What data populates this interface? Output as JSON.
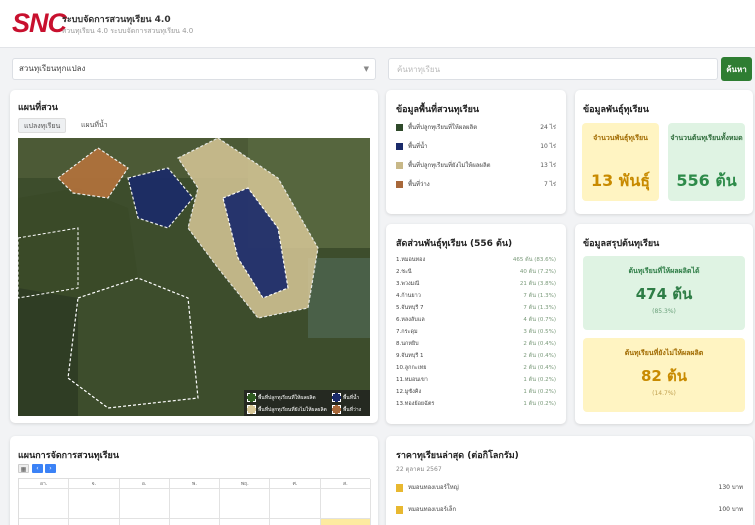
{
  "header": {
    "logo": "SNC",
    "title": "ระบบจัดการสวนทุเรียน 4.0",
    "subtitle": "สวนทุเรียน 4.0 ระบบจัดการสวนทุเรียน 4.0"
  },
  "filter": {
    "select_value": "สวนทุเรียนทุกแปลง",
    "search_placeholder": "ค้นหาทุเรียน",
    "search_button": "ค้นหา"
  },
  "map": {
    "title": "แผนที่สวน",
    "tabs": [
      "แปลงทุเรียน",
      "แผนที่น้ำ"
    ],
    "legend": [
      {
        "label": "พื้นที่ปลูกทุเรียนที่ให้ผลผลิต",
        "color": "#2f5a20"
      },
      {
        "label": "พื้นที่น้ำ",
        "color": "#1a2a6a"
      },
      {
        "label": "พื้นที่ปลูกทุเรียนที่ยังไม่ให้ผลผลิต",
        "color": "#d8c898"
      },
      {
        "label": "พื้นที่ว่าง",
        "color": "#a8683a"
      }
    ]
  },
  "area": {
    "title": "ข้อมูลพื้นที่สวนทุเรียน",
    "rows": [
      {
        "label": "พื้นที่ปลูกทุเรียนที่ให้ผลผลิต",
        "value": "24 ไร่",
        "color": "#2f4a2a"
      },
      {
        "label": "พื้นที่น้ำ",
        "value": "10 ไร่",
        "color": "#1a2a6a"
      },
      {
        "label": "พื้นที่ปลูกทุเรียนที่ยังไม่ให้ผลผลิต",
        "value": "13 ไร่",
        "color": "#c8b888"
      },
      {
        "label": "พื้นที่ว่าง",
        "value": "7 ไร่",
        "color": "#a8683a"
      }
    ]
  },
  "varieties": {
    "title": "ข้อมูลพันธุ์ทุเรียน",
    "count_label": "จำนวนพันธุ์ทุเรียน",
    "count_value": "13 พันธุ์",
    "trees_label": "จำนวนต้นทุเรียนทั้งหมด",
    "trees_value": "556 ต้น"
  },
  "ratio": {
    "title": "สัดส่วนพันธุ์ทุเรียน (556 ต้น)",
    "rows": [
      {
        "name": "1.หมอนทอง",
        "value": "465 ต้น (83.6%)"
      },
      {
        "name": "2.ชะนี",
        "value": "40 ต้น (7.2%)"
      },
      {
        "name": "3.พวงมณี",
        "value": "21 ต้น (3.8%)"
      },
      {
        "name": "4.ก้านยาว",
        "value": "7 ต้น (1.3%)"
      },
      {
        "name": "5.จันทบุรี 7",
        "value": "7 ต้น (1.3%)"
      },
      {
        "name": "6.หลงลับแล",
        "value": "4 ต้น (0.7%)"
      },
      {
        "name": "7.กระดุม",
        "value": "3 ต้น (0.5%)"
      },
      {
        "name": "8.นกหยิบ",
        "value": "2 ต้น (0.4%)"
      },
      {
        "name": "9.จันทบุรี 1",
        "value": "2 ต้น (0.4%)"
      },
      {
        "name": "10.ลูกกะเทย",
        "value": "2 ต้น (0.4%)"
      },
      {
        "name": "11.หมอนเขา",
        "value": "1 ต้น (0.2%)"
      },
      {
        "name": "12.มูซังคิง",
        "value": "1 ต้น (0.2%)"
      },
      {
        "name": "13.ทองย้อยฉัตร",
        "value": "1 ต้น (0.2%)"
      }
    ]
  },
  "productivity": {
    "title": "ข้อมูลสรุปต้นทุเรียน",
    "yield_label": "ต้นทุเรียนที่ให้ผลผลิตได้",
    "yield_value": "474 ต้น",
    "yield_pct": "(85.3%)",
    "noyield_label": "ต้นทุเรียนที่ยังไม่ให้ผลผลิต",
    "noyield_value": "82 ต้น",
    "noyield_pct": "(14.7%)"
  },
  "plan": {
    "title": "แผนการจัดการสวนทุเรียน",
    "days": [
      "อา.",
      "จ.",
      "อ.",
      "พ.",
      "พฤ.",
      "ศ.",
      "ส."
    ]
  },
  "price": {
    "title": "ราคาทุเรียนล่าสุด (ต่อกิโลกรัม)",
    "date": "22 ตุลาคม 2567",
    "rows": [
      {
        "label": "หมอนทองเบอร์ใหญ่",
        "value": "130 บาท"
      },
      {
        "label": "หมอนทองเบอร์เล็ก",
        "value": "100 บาท"
      }
    ]
  }
}
